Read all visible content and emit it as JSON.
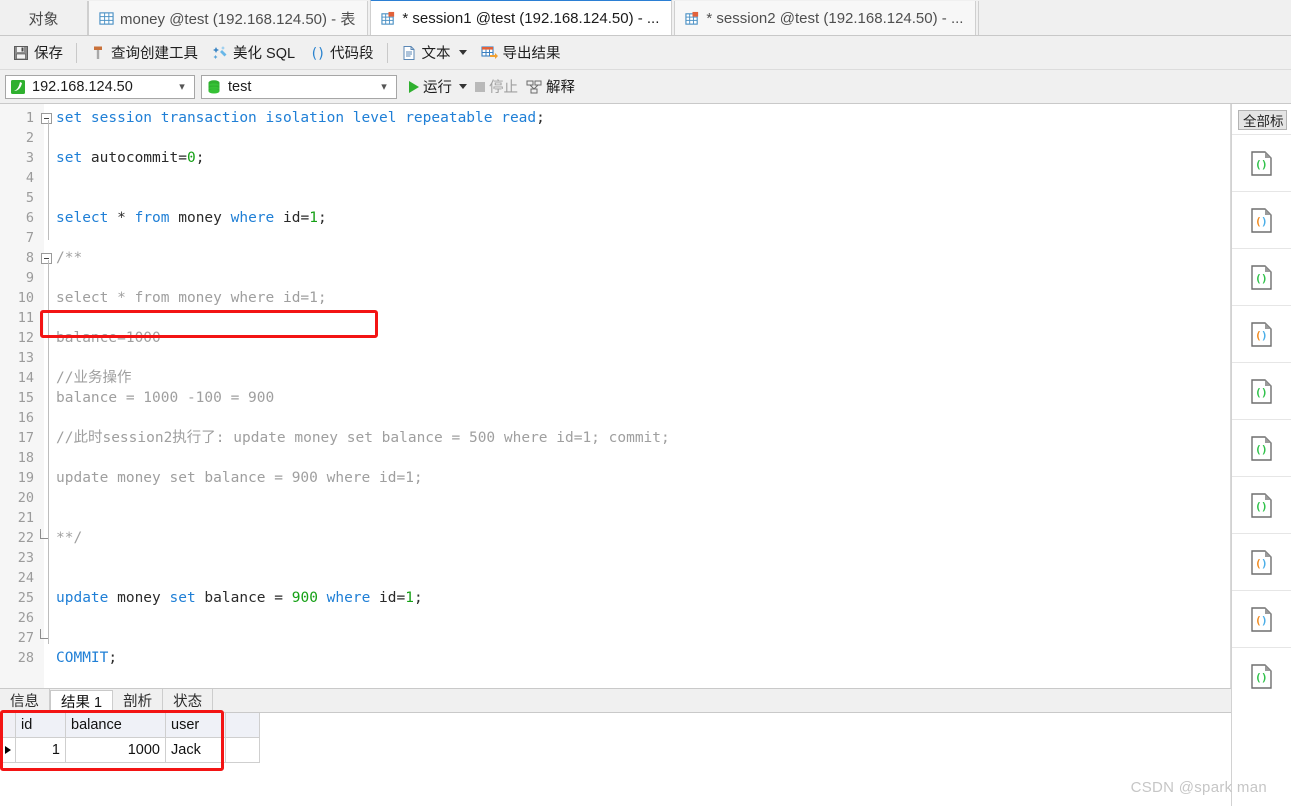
{
  "tabstrip": {
    "object_tab": "对象",
    "tabs": [
      {
        "label": "money @test (192.168.124.50) - 表",
        "icon": "table-grid-icon",
        "active": false,
        "modified": false
      },
      {
        "label": "* session1 @test (192.168.124.50) - ...",
        "icon": "table-grid-icon",
        "active": true,
        "modified": true
      },
      {
        "label": "* session2 @test (192.168.124.50) - ...",
        "icon": "table-grid-icon",
        "active": false,
        "modified": true
      }
    ]
  },
  "toolbar": {
    "save_label": "保存",
    "save_icon": "save-disk-icon",
    "query_builder_label": "查询创建工具",
    "query_builder_icon": "query-builder-icon",
    "beautify_label": "美化 SQL",
    "beautify_icon": "magic-wand-icon",
    "snippet_label": "代码段",
    "snippet_icon": "code-parens-icon",
    "text_label": "文本",
    "text_icon": "document-text-icon",
    "export_label": "导出结果",
    "export_icon": "export-grid-icon"
  },
  "connbar": {
    "connection_value": "192.168.124.50",
    "connection_icon": "connection-icon",
    "database_value": "test",
    "database_icon": "database-icon",
    "run_label": "运行",
    "run_icon": "play-triangle-icon",
    "stop_label": "停止",
    "stop_icon": "stop-square-icon",
    "explain_label": "解释",
    "explain_icon": "explain-plan-icon"
  },
  "editor": {
    "lines": [
      {
        "n": 1,
        "fold": "open",
        "tokens": [
          {
            "t": "set session transaction isolation level repeatable read",
            "c": "kw"
          },
          {
            "t": ";",
            "c": "punc"
          }
        ]
      },
      {
        "n": 2,
        "fold": "bar",
        "tokens": []
      },
      {
        "n": 3,
        "fold": "bar",
        "tokens": [
          {
            "t": "set",
            "c": "kw"
          },
          {
            "t": " autocommit=",
            "c": "plain"
          },
          {
            "t": "0",
            "c": "num"
          },
          {
            "t": ";",
            "c": "punc"
          }
        ]
      },
      {
        "n": 4,
        "fold": "bar",
        "tokens": []
      },
      {
        "n": 5,
        "fold": "bar",
        "tokens": []
      },
      {
        "n": 6,
        "fold": "bar",
        "tokens": [
          {
            "t": "select",
            "c": "kw"
          },
          {
            "t": " * ",
            "c": "plain"
          },
          {
            "t": "from",
            "c": "kw"
          },
          {
            "t": " money ",
            "c": "plain"
          },
          {
            "t": "where",
            "c": "kw"
          },
          {
            "t": " id=",
            "c": "plain"
          },
          {
            "t": "1",
            "c": "num"
          },
          {
            "t": ";",
            "c": "punc"
          }
        ]
      },
      {
        "n": 7,
        "fold": "bar",
        "tokens": []
      },
      {
        "n": 8,
        "fold": "open",
        "tokens": [
          {
            "t": "/**",
            "c": "cmt"
          }
        ]
      },
      {
        "n": 9,
        "fold": "bar",
        "tokens": []
      },
      {
        "n": 10,
        "fold": "bar",
        "tokens": [
          {
            "t": "select * from money where id=1;",
            "c": "cmt"
          }
        ]
      },
      {
        "n": 11,
        "fold": "bar",
        "tokens": []
      },
      {
        "n": 12,
        "fold": "bar",
        "tokens": [
          {
            "t": "balance=1000",
            "c": "cmt"
          }
        ]
      },
      {
        "n": 13,
        "fold": "bar",
        "tokens": []
      },
      {
        "n": 14,
        "fold": "bar",
        "tokens": [
          {
            "t": "//业务操作",
            "c": "cmt"
          }
        ]
      },
      {
        "n": 15,
        "fold": "bar",
        "tokens": [
          {
            "t": "balance = 1000 -100 = 900",
            "c": "cmt"
          }
        ]
      },
      {
        "n": 16,
        "fold": "bar",
        "tokens": []
      },
      {
        "n": 17,
        "fold": "bar",
        "tokens": [
          {
            "t": "//此时session2执行了: update money set balance = 500 where id=1; commit;",
            "c": "cmt"
          }
        ]
      },
      {
        "n": 18,
        "fold": "bar",
        "tokens": []
      },
      {
        "n": 19,
        "fold": "bar",
        "tokens": [
          {
            "t": "update money set balance = 900 where id=1;",
            "c": "cmt"
          }
        ]
      },
      {
        "n": 20,
        "fold": "bar",
        "tokens": []
      },
      {
        "n": 21,
        "fold": "bar",
        "tokens": []
      },
      {
        "n": 22,
        "fold": "close",
        "tokens": [
          {
            "t": "**/",
            "c": "cmt"
          }
        ]
      },
      {
        "n": 23,
        "fold": "bar",
        "tokens": []
      },
      {
        "n": 24,
        "fold": "bar",
        "tokens": []
      },
      {
        "n": 25,
        "fold": "bar",
        "tokens": [
          {
            "t": "update",
            "c": "kw"
          },
          {
            "t": " money ",
            "c": "plain"
          },
          {
            "t": "set",
            "c": "kw"
          },
          {
            "t": " balance = ",
            "c": "plain"
          },
          {
            "t": "900",
            "c": "num"
          },
          {
            "t": " ",
            "c": "plain"
          },
          {
            "t": "where",
            "c": "kw"
          },
          {
            "t": " id=",
            "c": "plain"
          },
          {
            "t": "1",
            "c": "num"
          },
          {
            "t": ";",
            "c": "punc"
          }
        ]
      },
      {
        "n": 26,
        "fold": "bar",
        "tokens": []
      },
      {
        "n": 27,
        "fold": "endbar",
        "tokens": []
      },
      {
        "n": 28,
        "fold": "none",
        "tokens": [
          {
            "t": "COMMIT",
            "c": "kw"
          },
          {
            "t": ";",
            "c": "punc"
          }
        ]
      }
    ],
    "highlight_color": "#f31414"
  },
  "results": {
    "tabs": [
      {
        "label": "信息",
        "active": false
      },
      {
        "label": "结果 1",
        "active": true
      },
      {
        "label": "剖析",
        "active": false
      },
      {
        "label": "状态",
        "active": false
      }
    ],
    "columns": [
      "id",
      "balance",
      "user"
    ],
    "rows": [
      {
        "indicator": "row-selector-arrow",
        "id": "1",
        "balance": "1000",
        "user": "Jack"
      }
    ]
  },
  "sidebar": {
    "header_label": "全部标",
    "items": [
      {
        "icon": "sql-file-icon",
        "variant": "green"
      },
      {
        "icon": "sql-file-icon",
        "variant": "orange"
      },
      {
        "icon": "sql-file-icon",
        "variant": "green"
      },
      {
        "icon": "sql-file-icon",
        "variant": "orange"
      },
      {
        "icon": "sql-file-icon",
        "variant": "green"
      },
      {
        "icon": "sql-file-icon",
        "variant": "green"
      },
      {
        "icon": "sql-file-icon",
        "variant": "green"
      },
      {
        "icon": "sql-file-icon",
        "variant": "orange"
      },
      {
        "icon": "sql-file-icon",
        "variant": "orange"
      },
      {
        "icon": "sql-file-icon",
        "variant": "green"
      }
    ]
  },
  "watermark": "CSDN @spark man"
}
